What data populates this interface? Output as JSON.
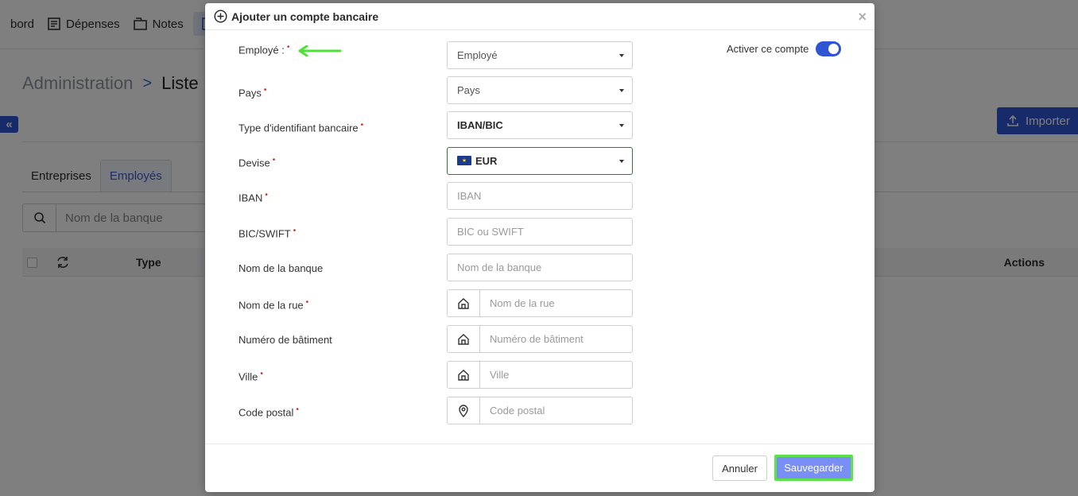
{
  "background": {
    "nav": [
      {
        "label": "bord"
      },
      {
        "label": "Dépenses"
      },
      {
        "label": "Notes"
      }
    ],
    "breadcrumb": {
      "parent": "Administration",
      "separator": ">",
      "current": "Liste"
    },
    "collapse_icon": "«",
    "import_label": "Importer",
    "tabs": [
      {
        "label": "Entreprises"
      },
      {
        "label": "Employés"
      }
    ],
    "search_placeholder": "Nom de la banque",
    "table": {
      "col_type": "Type",
      "col_actions": "Actions"
    }
  },
  "modal": {
    "title": "Ajouter un compte bancaire",
    "close": "×",
    "toggle": {
      "label": "Activer ce compte",
      "on": true
    },
    "fields": {
      "employee": {
        "label": "Employé :",
        "placeholder": "Employé"
      },
      "country": {
        "label": "Pays",
        "placeholder": "Pays"
      },
      "id_type": {
        "label": "Type d'identifiant bancaire",
        "value": "IBAN/BIC"
      },
      "currency": {
        "label": "Devise",
        "value": "EUR"
      },
      "iban": {
        "label": "IBAN",
        "placeholder": "IBAN"
      },
      "bic": {
        "label": "BIC/SWIFT",
        "placeholder": "BIC ou SWIFT"
      },
      "bank_name": {
        "label": "Nom de la banque",
        "placeholder": "Nom de la banque"
      },
      "street": {
        "label": "Nom de la rue",
        "placeholder": "Nom de la rue"
      },
      "building": {
        "label": "Numéro de bâtiment",
        "placeholder": "Numéro de bâtiment"
      },
      "city": {
        "label": "Ville",
        "placeholder": "Ville"
      },
      "postal": {
        "label": "Code postal",
        "placeholder": "Code postal"
      }
    },
    "required_mark": "•",
    "buttons": {
      "cancel": "Annuler",
      "save": "Sauvegarder"
    }
  },
  "colors": {
    "primary": "#2f55d4",
    "highlight": "#5ee04a",
    "required": "#e02424"
  }
}
